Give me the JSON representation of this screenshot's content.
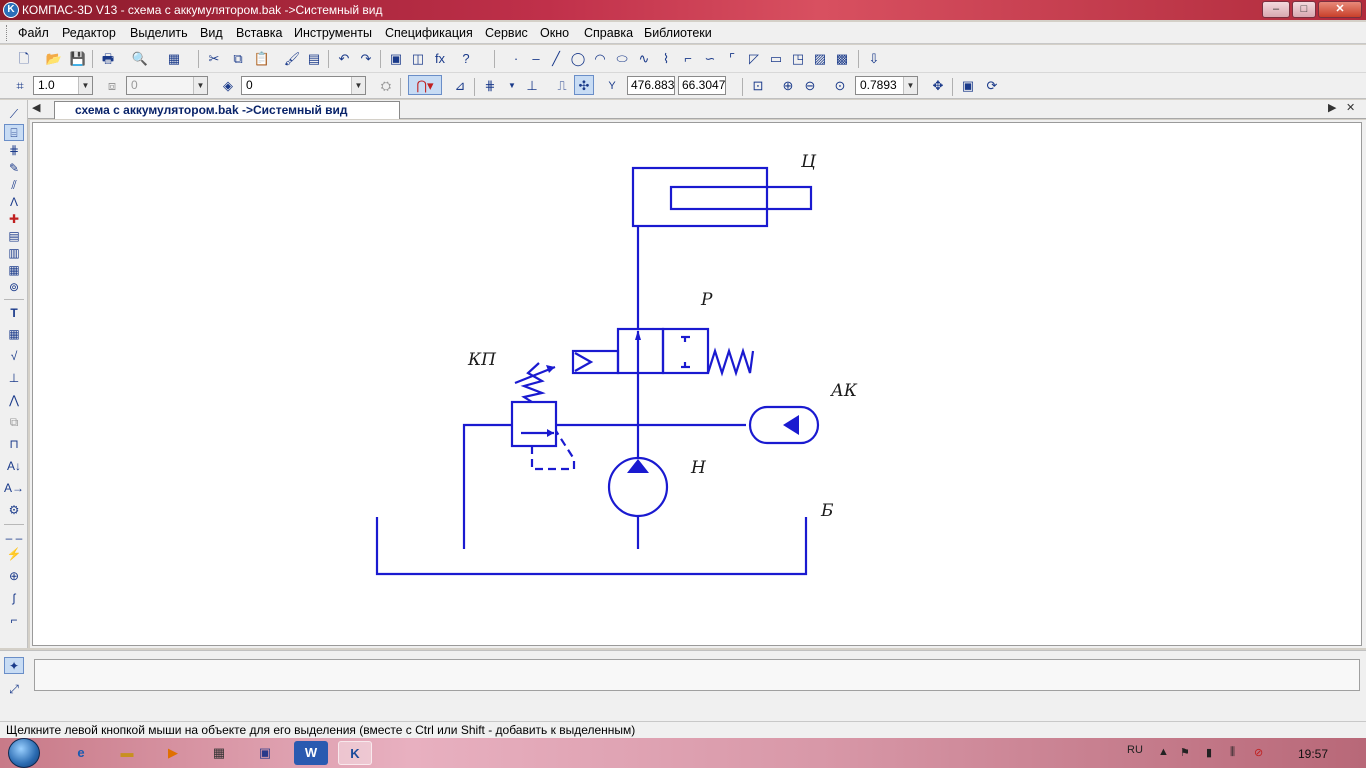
{
  "window": {
    "title": "КОМПАС-3D V13 - схема с аккумулятором.bak ->Системный вид",
    "icon": "kompas-logo-icon",
    "controls": {
      "minimize": "–",
      "maximize": "□",
      "close": "✕"
    }
  },
  "menu": [
    "Файл",
    "Редактор",
    "Выделить",
    "Вид",
    "Вставка",
    "Инструменты",
    "Спецификация",
    "Сервис",
    "Окно",
    "Справка",
    "Библиотеки"
  ],
  "toolbar_current_state": {
    "scale": "1.0",
    "layer_state": "0",
    "style_value": "0",
    "coord_x": "476.883",
    "coord_y": "66.3047",
    "zoom": "0.7893",
    "coord_prefix": "Y"
  },
  "document": {
    "tab_label": "схема с аккумулятором.bak ->Системный вид",
    "nav_prev": "◀",
    "nav_next": "▶",
    "close": "✕"
  },
  "diagram": {
    "labels": {
      "cylinder": "Ц",
      "distributor": "Р",
      "relief_valve": "КП",
      "accumulator": "АК",
      "pump": "Н",
      "tank": "Б"
    },
    "line_color": "#1a1ad0"
  },
  "status": {
    "message": "Щелкните левой кнопкой мыши на объекте для его выделения (вместе с Ctrl или Shift - добавить к выделенным)"
  },
  "taskbar": {
    "lang": "RU",
    "clock": "19:57"
  }
}
